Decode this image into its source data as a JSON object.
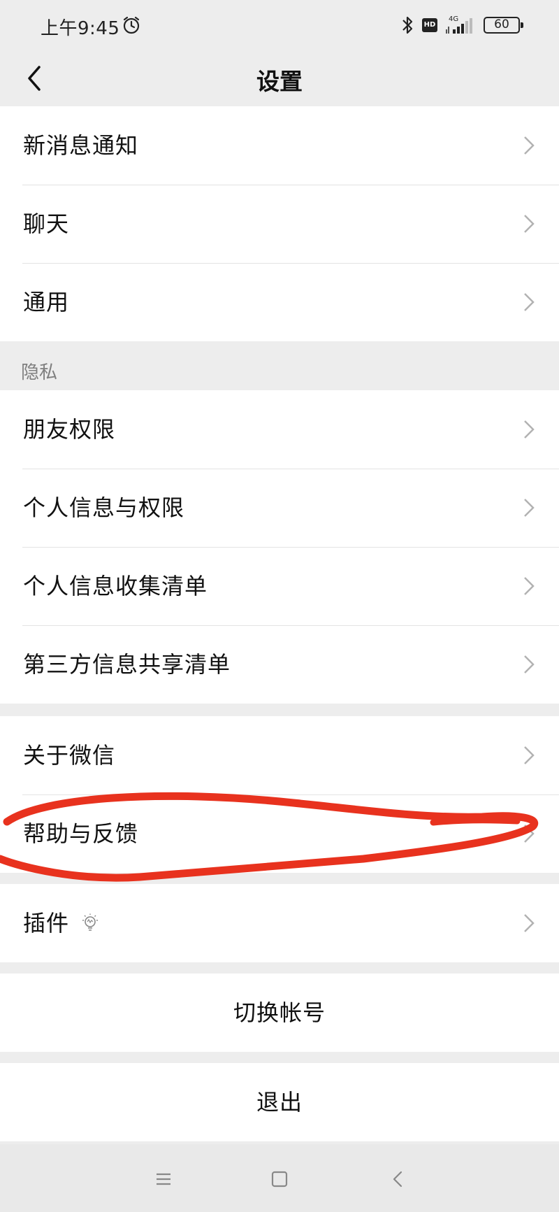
{
  "status_bar": {
    "time": "上午9:45",
    "hd_badge": "HD",
    "network": "4G",
    "battery": "60"
  },
  "nav": {
    "title": "设置"
  },
  "group1": {
    "items": [
      {
        "label": "新消息通知"
      },
      {
        "label": "聊天"
      },
      {
        "label": "通用"
      }
    ]
  },
  "privacy": {
    "header": "隐私",
    "items": [
      {
        "label": "朋友权限"
      },
      {
        "label": "个人信息与权限"
      },
      {
        "label": "个人信息收集清单"
      },
      {
        "label": "第三方信息共享清单"
      }
    ]
  },
  "about": {
    "items": [
      {
        "label": "关于微信"
      },
      {
        "label": "帮助与反馈"
      }
    ]
  },
  "plugins": {
    "label": "插件"
  },
  "actions": {
    "switch_account": "切换帐号",
    "logout": "退出"
  },
  "colors": {
    "annotation": "#e8321e",
    "background": "#ededed"
  }
}
